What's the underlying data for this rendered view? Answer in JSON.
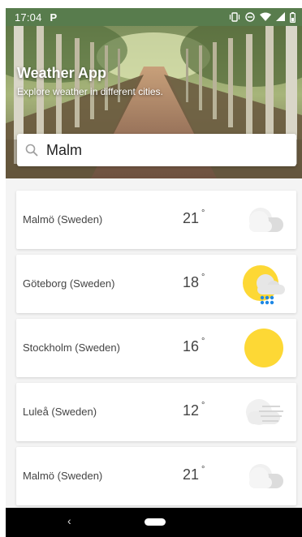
{
  "status_bar": {
    "time": "17:04",
    "app_indicator": "P",
    "icons": [
      "vibrate-icon",
      "dnd-icon",
      "wifi-icon",
      "signal-icon",
      "battery-icon"
    ]
  },
  "hero": {
    "title": "Weather App",
    "subtitle": "Explore weather in different cities."
  },
  "search": {
    "value": "Malm",
    "icon": "search-icon"
  },
  "results": [
    {
      "city": "Malmö (Sweden)",
      "temp": "21",
      "deg": "°",
      "icon": "cloudy-icon"
    },
    {
      "city": "Göteborg (Sweden)",
      "temp": "18",
      "deg": "°",
      "icon": "sun-rain-icon"
    },
    {
      "city": "Stockholm (Sweden)",
      "temp": "16",
      "deg": "°",
      "icon": "sunny-icon"
    },
    {
      "city": "Luleå (Sweden)",
      "temp": "12",
      "deg": "°",
      "icon": "windy-cloud-icon"
    },
    {
      "city": "Malmö (Sweden)",
      "temp": "21",
      "deg": "°",
      "icon": "cloudy-icon"
    }
  ],
  "nav": {
    "back_glyph": "‹"
  },
  "colors": {
    "status_bar": "#587c4d",
    "sun": "#fdd835",
    "rain": "#1e88e5",
    "cloud": "#e0e0e0"
  }
}
